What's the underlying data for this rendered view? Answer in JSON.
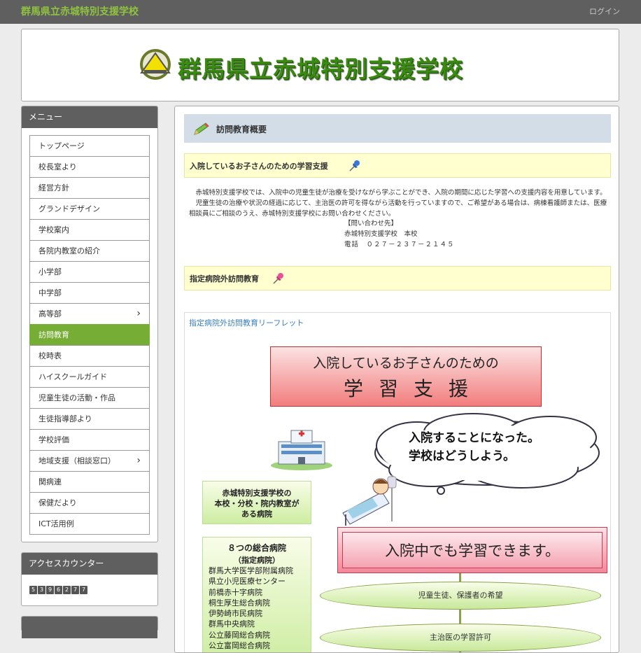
{
  "header": {
    "site_title": "群馬県立赤城特別支援学校",
    "login_label": "ログイン"
  },
  "banner": {
    "school_name": "群馬県立赤城特別支援学校"
  },
  "sidebar": {
    "menu_heading": "メニュー",
    "items": [
      {
        "label": "トップページ"
      },
      {
        "label": "校長室より"
      },
      {
        "label": "経営方針"
      },
      {
        "label": "グランドデザイン"
      },
      {
        "label": "学校案内"
      },
      {
        "label": "各院内教室の紹介"
      },
      {
        "label": "小学部"
      },
      {
        "label": "中学部"
      },
      {
        "label": "高等部",
        "has_sub": true
      },
      {
        "label": "訪問教育",
        "active": true
      },
      {
        "label": "校時表"
      },
      {
        "label": "ハイスクールガイド"
      },
      {
        "label": "児童生徒の活動・作品"
      },
      {
        "label": "生徒指導部より"
      },
      {
        "label": "学校評価"
      },
      {
        "label": "地域支援（相談窓口）",
        "has_sub": true
      },
      {
        "label": "関病連"
      },
      {
        "label": "保健だより"
      },
      {
        "label": "ICT活用例"
      }
    ],
    "counter_heading": "アクセスカウンター",
    "counter_digits": [
      "5",
      "3",
      "9",
      "6",
      "2",
      "7",
      "7"
    ]
  },
  "main": {
    "page_title": "訪問教育概要",
    "section1_title": "入院しているお子さんのための学習支援",
    "para_line1": "　赤城特別支援学校では、入院中の児童生徒が治療を受けながら学ぶことができ、入院の期間に応じた学習への支援内容を用意しています。",
    "para_line2": "　児童生徒の治療や状況の経過に応じて、主治医の許可を得ながら活動を行っていますので、ご希望がある場合は、病棟看護師または、医療相談員にご相談のうえ、赤城特別支援学校にお問い合わせください。",
    "contact_label": "【問い合わせ先】",
    "contact_name": "赤城特別支援学校　本校",
    "contact_phone": "電話　０２７－２３７－２１４５",
    "section2_title": "指定病院外訪問教育",
    "leaflet_link": "指定病院外訪問教育リーフレット",
    "leaflet": {
      "title_line1": "入院しているお子さんのための",
      "title_line2": "学習支援",
      "cloud_line1": "入院することになった。",
      "cloud_line2": "学校はどうしよう。",
      "green1_line1": "赤城特別支援学校の",
      "green1_line2": "本校・分校・院内教室が",
      "green1_line3": "ある病院",
      "green2_title": "８つの総合病院",
      "green2_sub": "（指定病院）",
      "hospitals": [
        "群馬大学医学部附属病院",
        "県立小児医療センター",
        "前橋赤十字病院",
        "桐生厚生総合病院",
        "伊勢崎市民病院",
        "群馬中央病院",
        "公立藤岡総合病院",
        "公立富岡総合病院"
      ],
      "pink_text": "入院中でも学習できます。",
      "ellipse1": "児童生徒、保護者の希望",
      "ellipse2": "主治医の学習許可"
    }
  }
}
